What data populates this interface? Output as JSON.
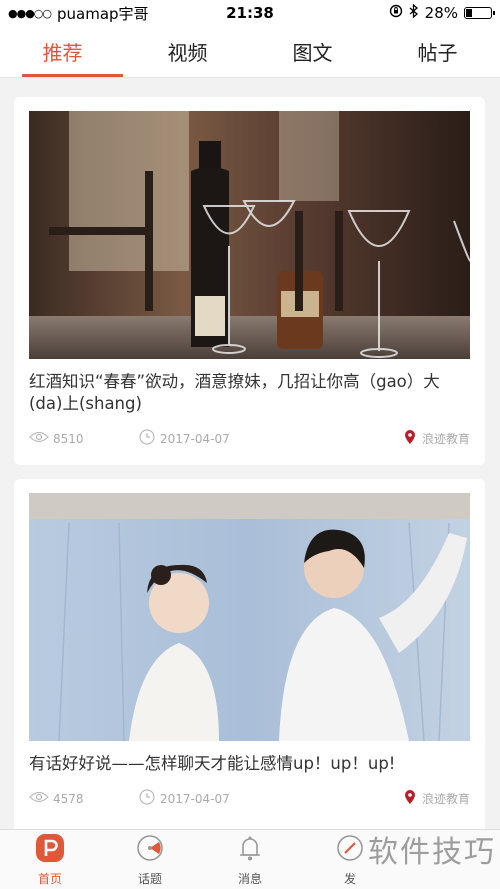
{
  "status_bar": {
    "carrier": "puamap宇哥",
    "time": "21:38",
    "battery": "28%",
    "battery_level": 0.28
  },
  "tabs": [
    {
      "label": "推荐",
      "active": true
    },
    {
      "label": "视频",
      "active": false
    },
    {
      "label": "图文",
      "active": false
    },
    {
      "label": "帖子",
      "active": false
    }
  ],
  "feed": [
    {
      "title": "红酒知识“春春”欲动，酒意撩妹，几招让你高（gao）大(da)上(shang)",
      "views": "8510",
      "date": "2017-04-07",
      "source": "浪迹教育"
    },
    {
      "title": "有话好好说——怎样聊天才能让感情up！up！up!",
      "views": "4578",
      "date": "2017-04-07",
      "source": "浪迹教育"
    }
  ],
  "bottom_nav": [
    {
      "label": "首页",
      "icon": "home-icon",
      "active": true
    },
    {
      "label": "话题",
      "icon": "topic-icon",
      "active": false
    },
    {
      "label": "消息",
      "icon": "bell-icon",
      "active": false
    },
    {
      "label": "发",
      "icon": "post-icon",
      "active": false
    }
  ],
  "watermark": "软件技巧",
  "colors": {
    "accent": "#e0583a",
    "location_pin": "#b3222b"
  }
}
